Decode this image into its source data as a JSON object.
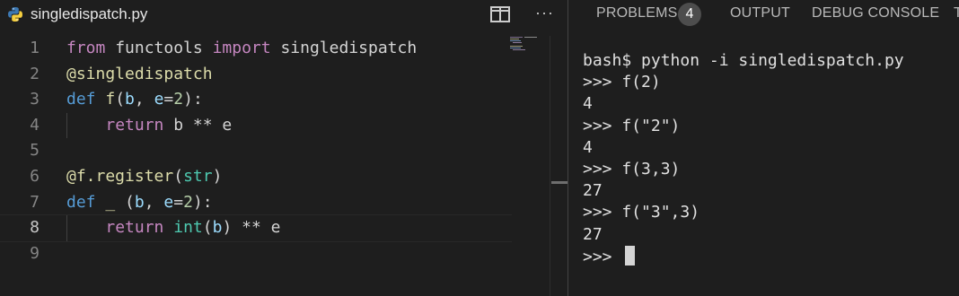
{
  "editor": {
    "tab_label": "singledispatch.py",
    "line_numbers": [
      "1",
      "2",
      "3",
      "4",
      "5",
      "6",
      "7",
      "8",
      "9"
    ],
    "active_line": 8,
    "code": {
      "l1": {
        "from": "from",
        "mod": " functools ",
        "import": "import",
        "name": " singledispatch"
      },
      "l2": {
        "deco": "@singledispatch"
      },
      "l3": {
        "def": "def",
        "sp": " ",
        "fname": "f",
        "p1": "(",
        "b": "b",
        "c": ", ",
        "e": "e",
        "eq": "=",
        "two": "2",
        "end": "):"
      },
      "l4": {
        "indent": "    ",
        "ret": "return",
        "rest": " b ** e"
      },
      "l6": {
        "deco": "@f.register",
        "p1": "(",
        "cls": "str",
        "p2": ")"
      },
      "l7": {
        "def": "def",
        "sp": " ",
        "fname": "_",
        "p1": " (",
        "b": "b",
        "c": ", ",
        "e": "e",
        "eq": "=",
        "two": "2",
        "end": "):"
      },
      "l8": {
        "indent": "    ",
        "ret": "return",
        "sp": " ",
        "int": "int",
        "p1": "(",
        "b": "b",
        "rest": ") ** e"
      }
    }
  },
  "panel": {
    "tabs": [
      "PROBLEMS",
      "OUTPUT",
      "DEBUG CONSOLE",
      "T"
    ],
    "problems_count": "4",
    "terminal_lines": [
      "bash$ python -i singledispatch.py",
      ">>> f(2)",
      "4",
      ">>> f(\"2\")",
      "4",
      ">>> f(3,3)",
      "27",
      ">>> f(\"3\",3)",
      "27",
      ">>> "
    ]
  },
  "colors": {
    "background": "#1e1e1e",
    "keyword": "#569cd6",
    "import": "#c586c0",
    "function": "#dcdcaa",
    "variable": "#9cdcfe",
    "number": "#b5cea8",
    "class": "#4ec9b0"
  },
  "icons": [
    "python-file-icon",
    "split-editor-icon",
    "more-actions-icon"
  ]
}
